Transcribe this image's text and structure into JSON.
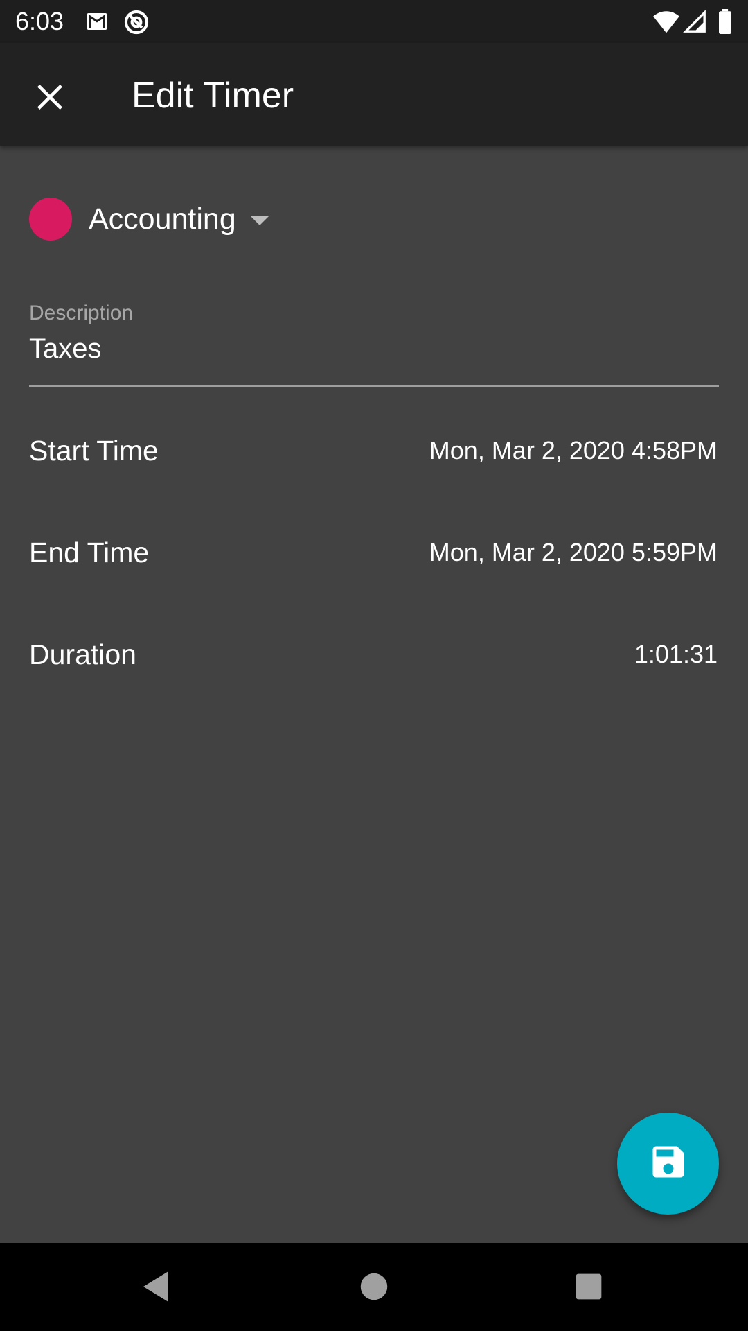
{
  "status_bar": {
    "time": "6:03",
    "left_icons": [
      "gmail-icon",
      "at-sign-icon"
    ],
    "right_icons": [
      "wifi-icon",
      "signal-icon",
      "battery-icon"
    ]
  },
  "app_bar": {
    "title": "Edit Timer",
    "close_icon": "close-icon"
  },
  "project": {
    "name": "Accounting",
    "color": "#d81b60"
  },
  "description": {
    "label": "Description",
    "value": "Taxes"
  },
  "rows": {
    "start_time": {
      "label": "Start Time",
      "value": "Mon, Mar 2, 2020 4:58PM"
    },
    "end_time": {
      "label": "End Time",
      "value": "Mon, Mar 2, 2020 5:59PM"
    },
    "duration": {
      "label": "Duration",
      "value": "1:01:31"
    }
  },
  "fab": {
    "icon": "save-icon",
    "color": "#00acc1"
  },
  "nav_bar": {
    "icons": [
      "back-icon",
      "home-icon",
      "recents-icon"
    ]
  },
  "colors": {
    "background": "#424242",
    "app_bar": "#222222",
    "status_bar": "#1e1e1e"
  }
}
